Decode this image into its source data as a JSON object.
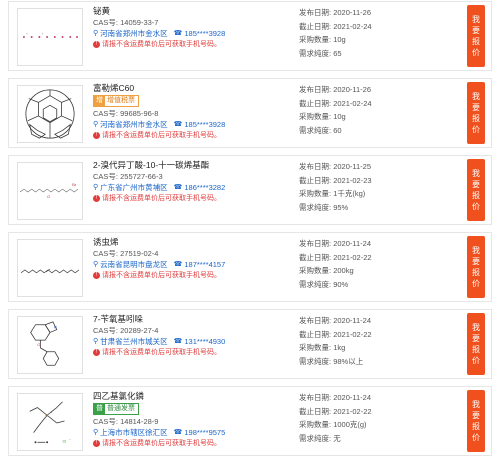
{
  "labels": {
    "publish": "发布日期:",
    "deadline": "截止日期:",
    "quantity": "采购数量:",
    "purity": "需求纯度:",
    "cas_prefix": "CAS号:",
    "warning": "请报不含运费单价后可获取手机号码。",
    "quote_button": [
      "我",
      "要",
      "报",
      "价"
    ]
  },
  "items": [
    {
      "name": "铋黄",
      "cas": "14059-33-7",
      "location": "河南省郑州市金水区",
      "phone": "185****3928",
      "badge": null,
      "publish": "2020-11-26",
      "deadline": "2021-02-24",
      "quantity": "10g",
      "purity": "65",
      "structure_icon": "ion-dots-icon"
    },
    {
      "name": "富勒烯C60",
      "cas": "99685-96-8",
      "location": "河南省郑州市金水区",
      "phone": "185****3928",
      "badge": {
        "tag": "增",
        "text": "增值税票",
        "color": "orange"
      },
      "publish": "2020-11-26",
      "deadline": "2021-02-24",
      "quantity": "10g",
      "purity": "60",
      "structure_icon": "fullerene-icon"
    },
    {
      "name": "2-溴代异丁酸-10-十一碳烯基酯",
      "cas": "255727-66-3",
      "location": "广东省广州市黄埔区",
      "phone": "186****3282",
      "badge": null,
      "publish": "2020-11-25",
      "deadline": "2021-02-23",
      "quantity": "1千克(kg)",
      "purity": "95%",
      "structure_icon": "long-chain-ester-icon"
    },
    {
      "name": "诱虫烯",
      "cas": "27519-02-4",
      "location": "云南省昆明市盘龙区",
      "phone": "187****4157",
      "badge": null,
      "publish": "2020-11-24",
      "deadline": "2021-02-22",
      "quantity": "200kg",
      "purity": "90%",
      "structure_icon": "alkene-chain-icon"
    },
    {
      "name": "7-苄氧基吲哚",
      "cas": "20289-27-4",
      "location": "甘肃省兰州市城关区",
      "phone": "131****4930",
      "badge": null,
      "publish": "2020-11-24",
      "deadline": "2021-02-22",
      "quantity": "1kg",
      "purity": "98%以上",
      "structure_icon": "benzyloxyindole-icon"
    },
    {
      "name": "四乙基氯化鏻",
      "cas": "14814-28-9",
      "location": "上海市市辖区徐汇区",
      "phone": "198****9575",
      "badge": {
        "tag": "普",
        "text": "普通发票",
        "color": "green"
      },
      "publish": "2020-11-24",
      "deadline": "2021-02-22",
      "quantity": "1000克(g)",
      "purity": "无",
      "structure_icon": "phosphonium-icon"
    }
  ]
}
